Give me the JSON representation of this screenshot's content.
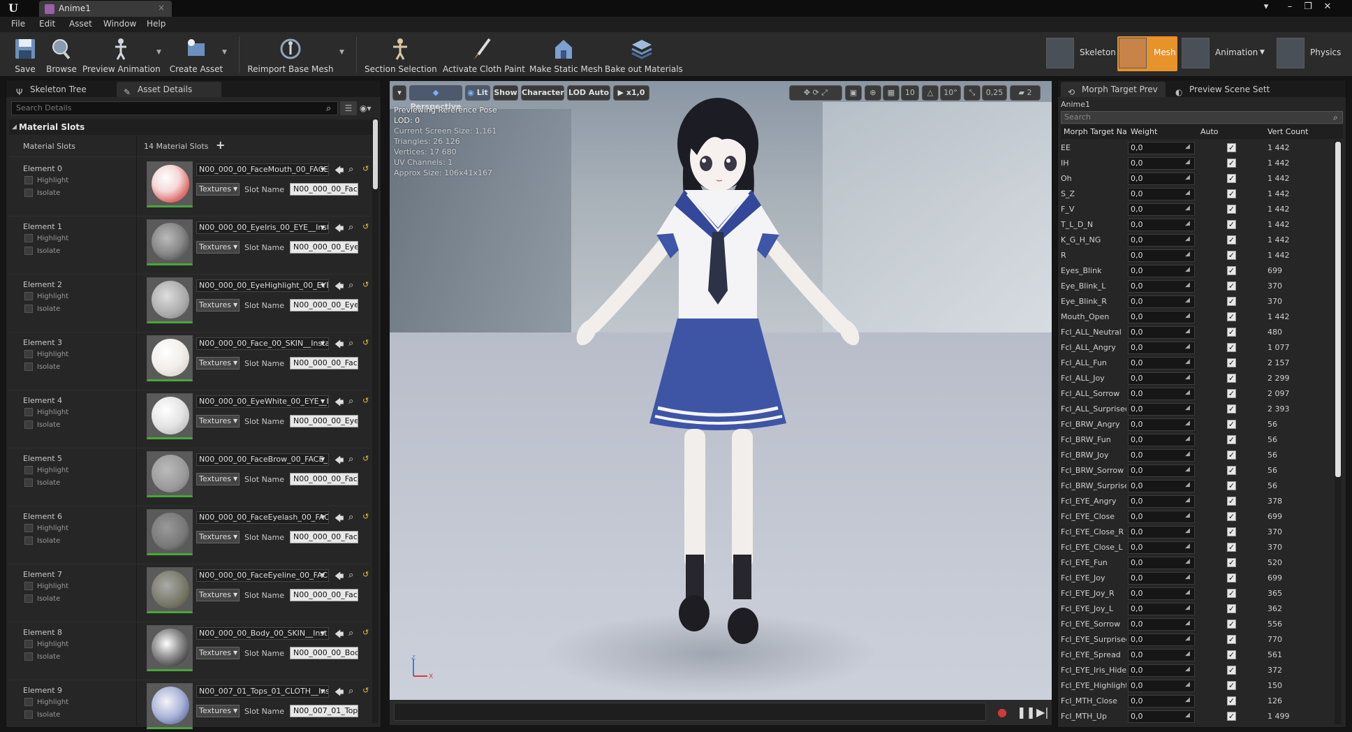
{
  "app": {
    "tab_title": "Anime1",
    "menu": [
      "File",
      "Edit",
      "Asset",
      "Window",
      "Help"
    ]
  },
  "toolbar": {
    "buttons": [
      {
        "label": "Save",
        "icon": "save-icon"
      },
      {
        "label": "Browse",
        "icon": "browse-icon"
      },
      {
        "label": "Preview Animation",
        "icon": "preview-animation-icon"
      },
      {
        "label": "Create Asset",
        "icon": "create-asset-icon"
      },
      {
        "label": "Reimport Base Mesh",
        "icon": "reimport-icon"
      },
      {
        "label": "Section Selection",
        "icon": "section-selection-icon"
      },
      {
        "label": "Activate Cloth Paint",
        "icon": "cloth-paint-icon"
      },
      {
        "label": "Make Static Mesh",
        "icon": "static-mesh-icon"
      },
      {
        "label": "Bake out Materials",
        "icon": "bake-materials-icon"
      }
    ],
    "modes": [
      {
        "label": "Skeleton",
        "active": false
      },
      {
        "label": "Mesh",
        "active": true
      },
      {
        "label": "Animation",
        "active": false
      },
      {
        "label": "Physics",
        "active": false
      }
    ]
  },
  "left_panel": {
    "tabs": [
      "Skeleton Tree",
      "Asset Details"
    ],
    "search_placeholder": "Search Details",
    "category": "Material Slots",
    "slots_label": "Material Slots",
    "slots_count": "14 Material Slots",
    "highlight_label": "Highlight",
    "isolate_label": "Isolate",
    "textures_label": "Textures",
    "slot_name_label": "Slot Name",
    "elements": [
      {
        "name": "Element 0",
        "material": "N00_000_00_FaceMouth_00_FACE",
        "slot": "N00_000_00_Face"
      },
      {
        "name": "Element 1",
        "material": "N00_000_00_EyeIris_00_EYE__Inst",
        "slot": "N00_000_00_EyeIr"
      },
      {
        "name": "Element 2",
        "material": "N00_000_00_EyeHighlight_00_EYE",
        "slot": "N00_000_00_EyeH"
      },
      {
        "name": "Element 3",
        "material": "N00_000_00_Face_00_SKIN__Insta",
        "slot": "N00_000_00_Face"
      },
      {
        "name": "Element 4",
        "material": "N00_000_00_EyeWhite_00_EYE__In",
        "slot": "N00_000_00_EyeW"
      },
      {
        "name": "Element 5",
        "material": "N00_000_00_FaceBrow_00_FACE_",
        "slot": "N00_000_00_Face"
      },
      {
        "name": "Element 6",
        "material": "N00_000_00_FaceEyelash_00_FAC",
        "slot": "N00_000_00_Face"
      },
      {
        "name": "Element 7",
        "material": "N00_000_00_FaceEyeline_00_FACE",
        "slot": "N00_000_00_Face"
      },
      {
        "name": "Element 8",
        "material": "N00_000_00_Body_00_SKIN__Inst",
        "slot": "N00_000_00_Body"
      },
      {
        "name": "Element 9",
        "material": "N00_007_01_Tops_01_CLOTH__Ins",
        "slot": "N00_007_01_Tops"
      }
    ]
  },
  "viewport": {
    "buttons": {
      "perspective": "Perspective",
      "lit": "Lit",
      "show": "Show",
      "character": "Character",
      "lod": "LOD Auto",
      "speed": "x1,0",
      "grid_size": "10",
      "rotation_snap": "10°",
      "scale_snap": "0,25",
      "camera_speed": "2"
    },
    "info": [
      "Previewing Reference Pose",
      "LOD: 0",
      "Current Screen Size: 1,161",
      "Triangles: 26 126",
      "Vertices: 17 680",
      "UV Channels: 1",
      "Approx Size: 106x41x167"
    ],
    "axis": {
      "z": "Z",
      "x": "X"
    }
  },
  "right_panel": {
    "tabs": [
      "Morph Target Prev",
      "Preview Scene Sett"
    ],
    "asset_name": "Anime1",
    "search_placeholder": "Search",
    "columns": [
      "Morph Target Na",
      "Weight",
      "Auto",
      "Vert Count"
    ],
    "morph_targets": [
      {
        "name": "EE",
        "weight": "0,0",
        "count": "1 442"
      },
      {
        "name": "IH",
        "weight": "0,0",
        "count": "1 442"
      },
      {
        "name": "Oh",
        "weight": "0,0",
        "count": "1 442"
      },
      {
        "name": "S_Z",
        "weight": "0,0",
        "count": "1 442"
      },
      {
        "name": "F_V",
        "weight": "0,0",
        "count": "1 442"
      },
      {
        "name": "T_L_D_N",
        "weight": "0,0",
        "count": "1 442"
      },
      {
        "name": "K_G_H_NG",
        "weight": "0,0",
        "count": "1 442"
      },
      {
        "name": "R",
        "weight": "0,0",
        "count": "1 442"
      },
      {
        "name": "Eyes_Blink",
        "weight": "0,0",
        "count": "699"
      },
      {
        "name": "Eye_Blink_L",
        "weight": "0,0",
        "count": "370"
      },
      {
        "name": "Eye_Blink_R",
        "weight": "0,0",
        "count": "370"
      },
      {
        "name": "Mouth_Open",
        "weight": "0,0",
        "count": "1 442"
      },
      {
        "name": "Fcl_ALL_Neutral",
        "weight": "0,0",
        "count": "480"
      },
      {
        "name": "Fcl_ALL_Angry",
        "weight": "0,0",
        "count": "1 077"
      },
      {
        "name": "Fcl_ALL_Fun",
        "weight": "0,0",
        "count": "2 157"
      },
      {
        "name": "Fcl_ALL_Joy",
        "weight": "0,0",
        "count": "2 299"
      },
      {
        "name": "Fcl_ALL_Sorrow",
        "weight": "0,0",
        "count": "2 097"
      },
      {
        "name": "Fcl_ALL_Surprised",
        "weight": "0,0",
        "count": "2 393"
      },
      {
        "name": "Fcl_BRW_Angry",
        "weight": "0,0",
        "count": "56"
      },
      {
        "name": "Fcl_BRW_Fun",
        "weight": "0,0",
        "count": "56"
      },
      {
        "name": "Fcl_BRW_Joy",
        "weight": "0,0",
        "count": "56"
      },
      {
        "name": "Fcl_BRW_Sorrow",
        "weight": "0,0",
        "count": "56"
      },
      {
        "name": "Fcl_BRW_Surprised",
        "weight": "0,0",
        "count": "56"
      },
      {
        "name": "Fcl_EYE_Angry",
        "weight": "0,0",
        "count": "378"
      },
      {
        "name": "Fcl_EYE_Close",
        "weight": "0,0",
        "count": "699"
      },
      {
        "name": "Fcl_EYE_Close_R",
        "weight": "0,0",
        "count": "370"
      },
      {
        "name": "Fcl_EYE_Close_L",
        "weight": "0,0",
        "count": "370"
      },
      {
        "name": "Fcl_EYE_Fun",
        "weight": "0,0",
        "count": "520"
      },
      {
        "name": "Fcl_EYE_Joy",
        "weight": "0,0",
        "count": "699"
      },
      {
        "name": "Fcl_EYE_Joy_R",
        "weight": "0,0",
        "count": "365"
      },
      {
        "name": "Fcl_EYE_Joy_L",
        "weight": "0,0",
        "count": "362"
      },
      {
        "name": "Fcl_EYE_Sorrow",
        "weight": "0,0",
        "count": "556"
      },
      {
        "name": "Fcl_EYE_Surprised",
        "weight": "0,0",
        "count": "770"
      },
      {
        "name": "Fcl_EYE_Spread",
        "weight": "0,0",
        "count": "561"
      },
      {
        "name": "Fcl_EYE_Iris_Hide",
        "weight": "0,0",
        "count": "372"
      },
      {
        "name": "Fcl_EYE_Highlight",
        "weight": "0,0",
        "count": "150"
      },
      {
        "name": "Fcl_MTH_Close",
        "weight": "0,0",
        "count": "126"
      },
      {
        "name": "Fcl_MTH_Up",
        "weight": "0,0",
        "count": "1 499"
      }
    ]
  },
  "colors": {
    "accent_mode": "#e8922a",
    "panel_bg": "#262626",
    "thumb_active_border": "#4aa63a"
  }
}
